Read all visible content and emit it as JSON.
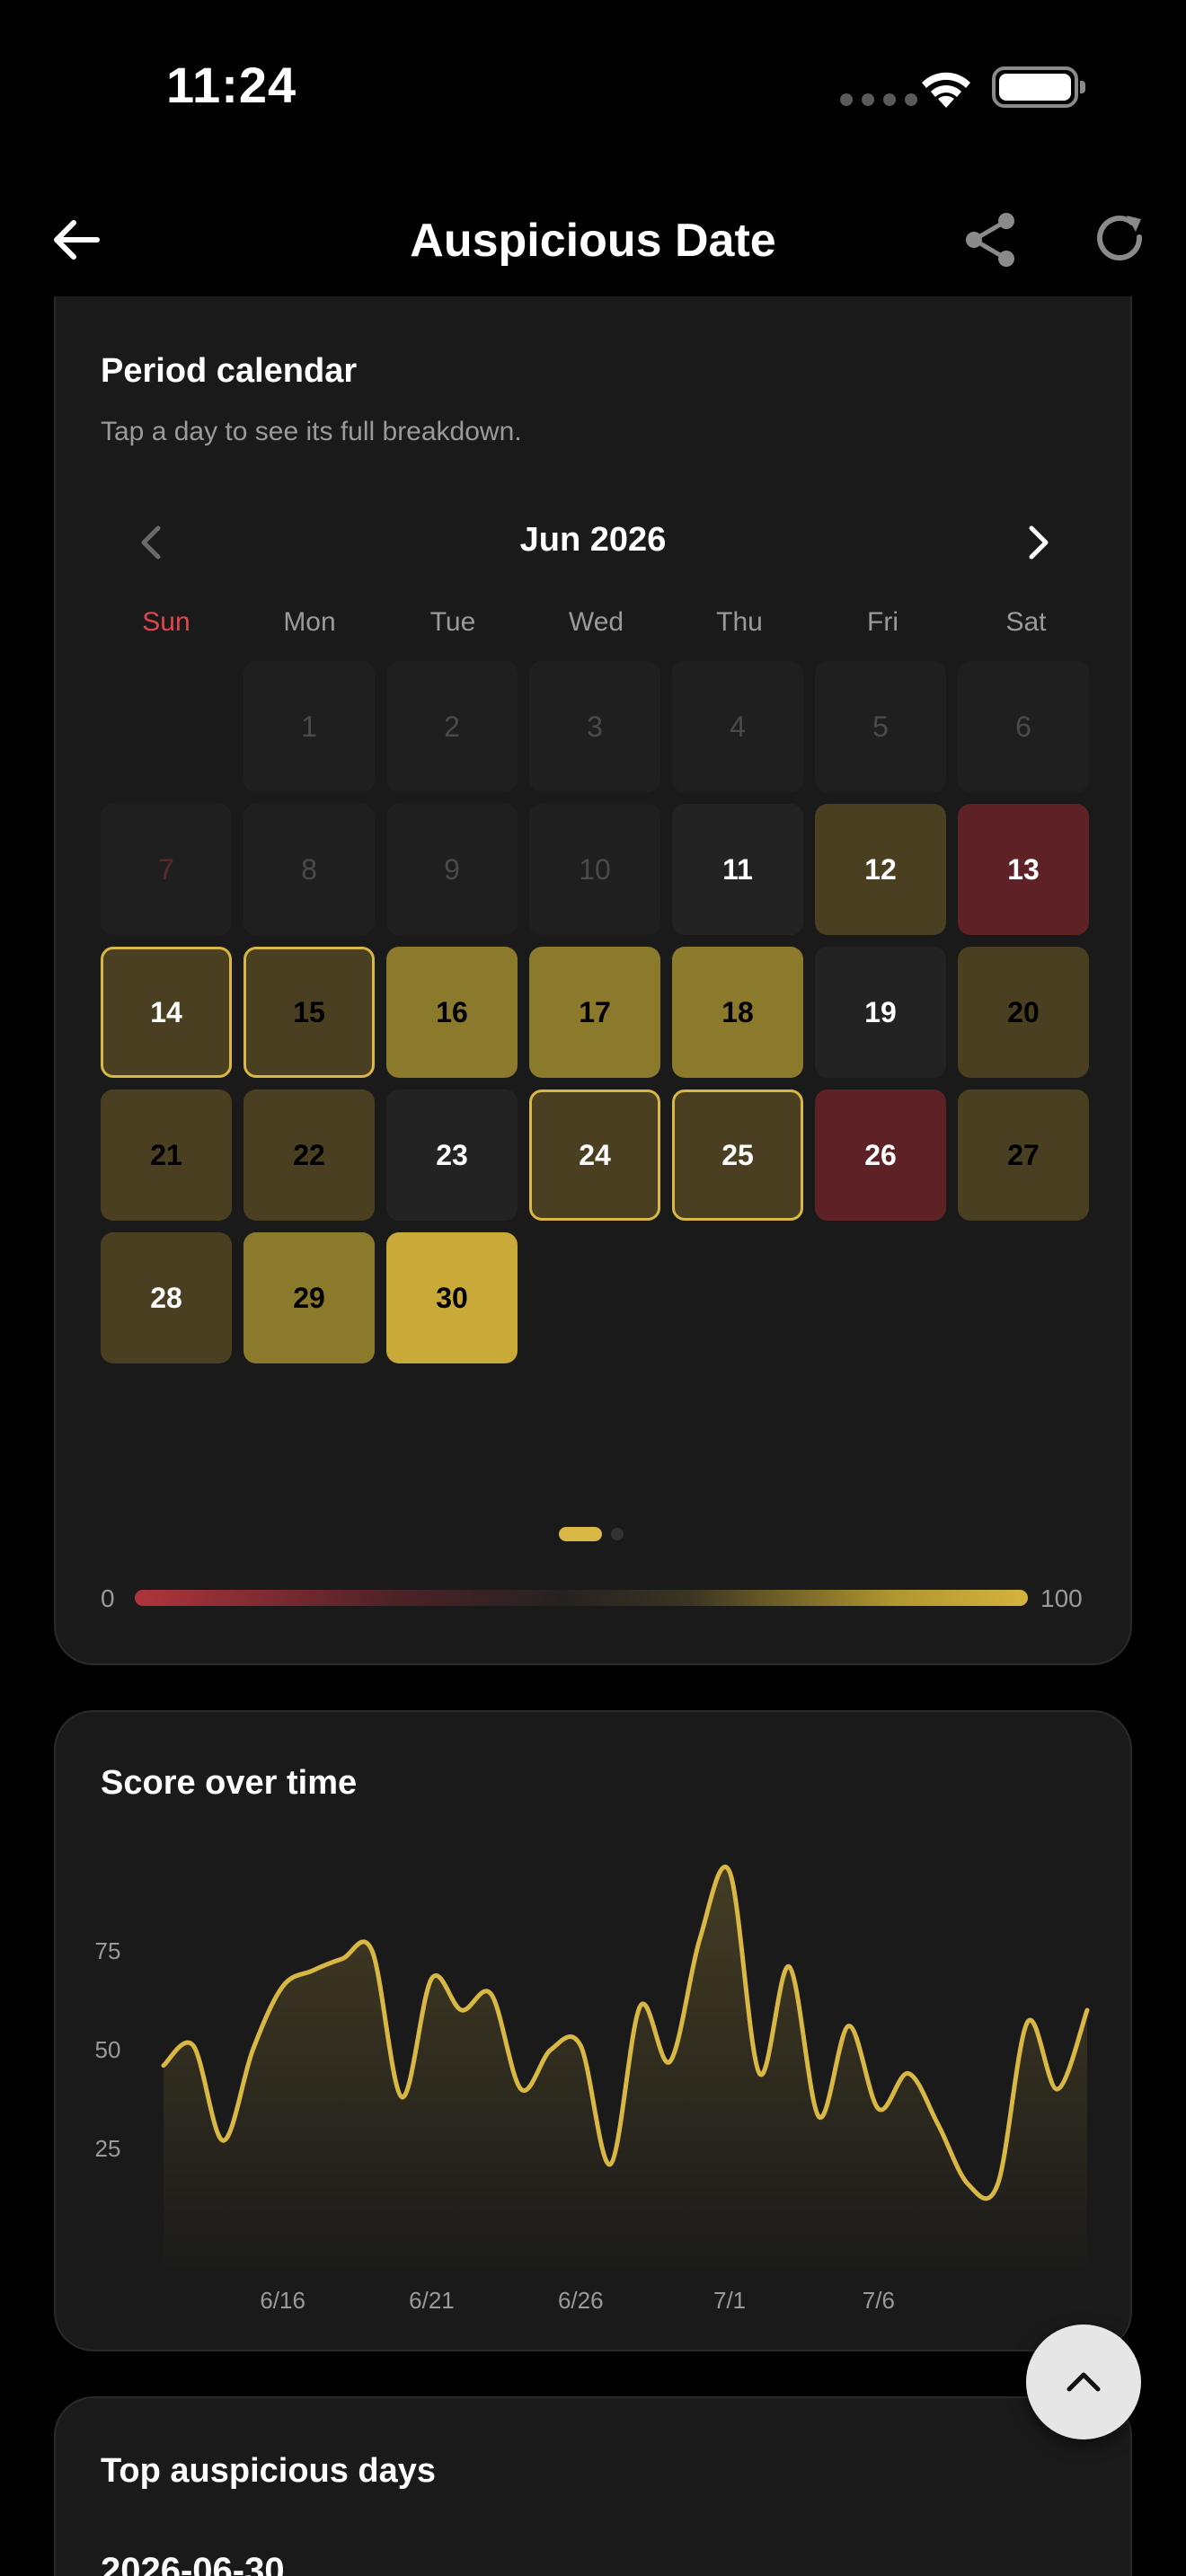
{
  "status_bar": {
    "time": "11:24"
  },
  "header": {
    "title": "Auspicious Date"
  },
  "calendar_card": {
    "title": "Period calendar",
    "subtitle": "Tap a day to see its full breakdown.",
    "month": "Jun 2026",
    "weekdays": [
      "Sun",
      "Mon",
      "Tue",
      "Wed",
      "Thu",
      "Fri",
      "Sat"
    ],
    "days": [
      {
        "label": "1",
        "style": "dim"
      },
      {
        "label": "2",
        "style": "dim"
      },
      {
        "label": "3",
        "style": "dim"
      },
      {
        "label": "4",
        "style": "dim"
      },
      {
        "label": "5",
        "style": "dim"
      },
      {
        "label": "6",
        "style": "dim"
      },
      {
        "label": "7",
        "style": "dimsun"
      },
      {
        "label": "8",
        "style": "dim"
      },
      {
        "label": "9",
        "style": "dim"
      },
      {
        "label": "10",
        "style": "dim"
      },
      {
        "label": "11",
        "style": "plain"
      },
      {
        "label": "12",
        "style": "olive-w"
      },
      {
        "label": "13",
        "style": "red"
      },
      {
        "label": "14",
        "style": "olive-w outlined"
      },
      {
        "label": "15",
        "style": "olive outlined"
      },
      {
        "label": "16",
        "style": "gold"
      },
      {
        "label": "17",
        "style": "gold"
      },
      {
        "label": "18",
        "style": "gold"
      },
      {
        "label": "19",
        "style": "plain"
      },
      {
        "label": "20",
        "style": "olive"
      },
      {
        "label": "21",
        "style": "olive"
      },
      {
        "label": "22",
        "style": "olive"
      },
      {
        "label": "23",
        "style": "plain"
      },
      {
        "label": "24",
        "style": "olive-w outlined"
      },
      {
        "label": "25",
        "style": "olive-w outlined"
      },
      {
        "label": "26",
        "style": "red"
      },
      {
        "label": "27",
        "style": "olive"
      },
      {
        "label": "28",
        "style": "olive-w"
      },
      {
        "label": "29",
        "style": "gold"
      },
      {
        "label": "30",
        "style": "gold-b"
      }
    ],
    "first_weekday_index": 1,
    "legend": {
      "min": "0",
      "max": "100"
    },
    "pager": {
      "pages": 2,
      "current": 1
    }
  },
  "score_card": {
    "title": "Score over time",
    "chart_data": {
      "type": "area",
      "x_tick_labels": [
        "6/16",
        "6/21",
        "6/26",
        "7/1",
        "7/6"
      ],
      "y_tick_labels": [
        "25",
        "50",
        "75"
      ],
      "ylim": [
        0,
        100
      ],
      "xlabel": "",
      "ylabel": "",
      "grid": false,
      "line_color": "#d9b745",
      "series": [
        {
          "x": [
            "6/12",
            "6/13",
            "6/14",
            "6/15",
            "6/16",
            "6/17",
            "6/18",
            "6/19",
            "6/20",
            "6/21",
            "6/22",
            "6/23",
            "6/24",
            "6/25",
            "6/26",
            "6/27",
            "6/28",
            "6/29",
            "6/30",
            "7/1",
            "7/2",
            "7/3",
            "7/4",
            "7/5",
            "7/6",
            "7/7",
            "7/8",
            "7/9",
            "7/10",
            "7/11",
            "7/12",
            "7/13"
          ],
          "values": [
            46,
            51,
            27,
            50,
            66,
            70,
            73,
            75,
            38,
            68,
            60,
            64,
            40,
            50,
            51,
            21,
            61,
            47,
            78,
            95,
            44,
            71,
            33,
            56,
            35,
            44,
            31,
            16,
            16,
            57,
            40,
            60
          ]
        }
      ]
    }
  },
  "top_card": {
    "title": "Top auspicious days",
    "first_date": "2026-06-30"
  },
  "colors": {
    "accent": "#d9b745",
    "negative": "#5e2226",
    "background": "#000000",
    "card": "#1a1a1a"
  }
}
